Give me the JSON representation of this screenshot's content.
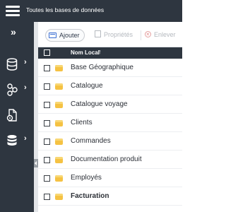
{
  "header": {
    "title": "Toutes les bases de données"
  },
  "sidebar": {
    "items": [
      {
        "name": "database-icon",
        "has_arrow": true
      },
      {
        "name": "network-icon",
        "has_arrow": true
      },
      {
        "name": "file-settings-icon",
        "has_arrow": false
      },
      {
        "name": "database-stack-icon",
        "has_arrow": true
      }
    ]
  },
  "toolbar": {
    "add_label": "Ajouter",
    "properties_label": "Propriétés",
    "remove_label": "Enlever"
  },
  "table": {
    "column_header": "Nom Local",
    "sort_icon": "↑",
    "rows": [
      {
        "label": "Base Géographique"
      },
      {
        "label": "Catalogue"
      },
      {
        "label": "Catalogue voyage"
      },
      {
        "label": "Clients"
      },
      {
        "label": "Commandes"
      },
      {
        "label": "Documentation produit"
      },
      {
        "label": "Employés"
      },
      {
        "label": "Facturation"
      }
    ]
  },
  "colors": {
    "sidebar_bg": "#2e3640",
    "db_icon": "#f5c243",
    "add_icon": "#3b6fd4"
  }
}
